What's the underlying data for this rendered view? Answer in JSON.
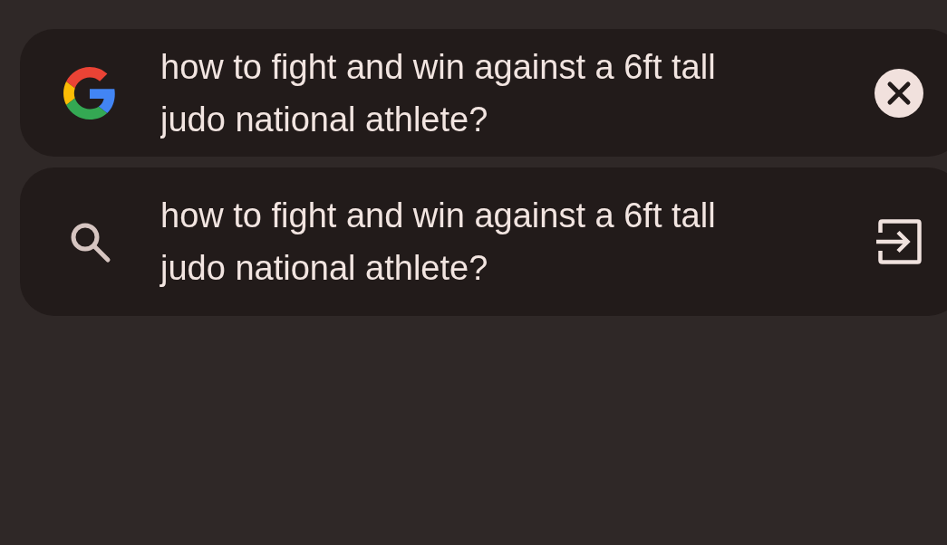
{
  "search_bar": {
    "value": "how to fight and win against a 6ft tall judo national athlete?"
  },
  "suggestions": [
    {
      "kind": "search",
      "text": "how to fight and win against a 6ft tall judo national athlete?"
    }
  ]
}
